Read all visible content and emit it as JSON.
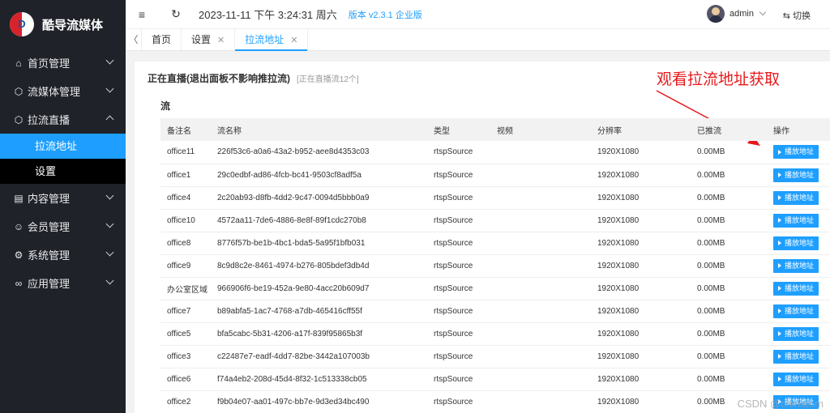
{
  "app": {
    "brand": "酷导流媒体",
    "logo_letter": "D"
  },
  "sidebar": {
    "items": [
      {
        "label": "首页管理",
        "icon": "home-icon",
        "glyph": "⌂"
      },
      {
        "label": "流媒体管理",
        "icon": "cube-icon",
        "glyph": "⬡"
      },
      {
        "label": "拉流直播",
        "icon": "cube-icon",
        "glyph": "⬡",
        "open": true
      },
      {
        "label": "内容管理",
        "icon": "document-icon",
        "glyph": "▤"
      },
      {
        "label": "会员管理",
        "icon": "users-icon",
        "glyph": "☺"
      },
      {
        "label": "系统管理",
        "icon": "gear-icon",
        "glyph": "⚙"
      },
      {
        "label": "应用管理",
        "icon": "link-icon",
        "glyph": "∞"
      }
    ],
    "sub_items": [
      {
        "label": "拉流地址",
        "active": true
      },
      {
        "label": "设置",
        "active": false
      }
    ]
  },
  "header": {
    "menu_icon": "≡",
    "refresh_icon": "↻",
    "datetime": "2023-11-11 下午 3:24:31 周六",
    "version": "版本 v2.3.1 企业版",
    "username": "admin",
    "switch_label": "⇆ 切换"
  },
  "tabs": {
    "prev": "〈",
    "items": [
      {
        "label": "首页",
        "closable": false,
        "active": false
      },
      {
        "label": "设置",
        "closable": true,
        "active": false
      },
      {
        "label": "拉流地址",
        "closable": true,
        "active": true
      }
    ]
  },
  "main": {
    "panel_title": "正在直播(退出面板不影响推拉流)",
    "panel_sub": "[正在直播流12个]",
    "annotation": "观看拉流地址获取",
    "section_label": "流",
    "columns": [
      "备注名",
      "流名称",
      "类型",
      "视频",
      "分辨率",
      "已推流",
      "操作"
    ],
    "play_label": "播放地址",
    "rows": [
      {
        "name": "office11",
        "stream": "226f53c6-a0a6-43a2-b952-aee8d4353c03",
        "type": "rtspSource",
        "video": "",
        "res": "1920X1080",
        "pushed": "0.00MB"
      },
      {
        "name": "office1",
        "stream": "29c0edbf-ad86-4fcb-bc41-9503cf8adf5a",
        "type": "rtspSource",
        "video": "",
        "res": "1920X1080",
        "pushed": "0.00MB"
      },
      {
        "name": "office4",
        "stream": "2c20ab93-d8fb-4dd2-9c47-0094d5bbb0a9",
        "type": "rtspSource",
        "video": "",
        "res": "1920X1080",
        "pushed": "0.00MB"
      },
      {
        "name": "office10",
        "stream": "4572aa11-7de6-4886-8e8f-89f1cdc270b8",
        "type": "rtspSource",
        "video": "",
        "res": "1920X1080",
        "pushed": "0.00MB"
      },
      {
        "name": "office8",
        "stream": "8776f57b-be1b-4bc1-bda5-5a95f1bfb031",
        "type": "rtspSource",
        "video": "",
        "res": "1920X1080",
        "pushed": "0.00MB"
      },
      {
        "name": "office9",
        "stream": "8c9d8c2e-8461-4974-b276-805bdef3db4d",
        "type": "rtspSource",
        "video": "",
        "res": "1920X1080",
        "pushed": "0.00MB"
      },
      {
        "name": "办公室区域",
        "stream": "966906f6-be19-452a-9e80-4acc20b609d7",
        "type": "rtspSource",
        "video": "",
        "res": "1920X1080",
        "pushed": "0.00MB"
      },
      {
        "name": "office7",
        "stream": "b89abfa5-1ac7-4768-a7db-465416cff55f",
        "type": "rtspSource",
        "video": "",
        "res": "1920X1080",
        "pushed": "0.00MB"
      },
      {
        "name": "office5",
        "stream": "bfa5cabc-5b31-4206-a17f-839f95865b3f",
        "type": "rtspSource",
        "video": "",
        "res": "1920X1080",
        "pushed": "0.00MB"
      },
      {
        "name": "office3",
        "stream": "c22487e7-eadf-4dd7-82be-3442a107003b",
        "type": "rtspSource",
        "video": "",
        "res": "1920X1080",
        "pushed": "0.00MB"
      },
      {
        "name": "office6",
        "stream": "f74a4eb2-208d-45d4-8f32-1c513338cb05",
        "type": "rtspSource",
        "video": "",
        "res": "1920X1080",
        "pushed": "0.00MB"
      },
      {
        "name": "office2",
        "stream": "f9b04e07-aa01-497c-bb7e-9d3ed34bc490",
        "type": "rtspSource",
        "video": "",
        "res": "1920X1080",
        "pushed": "0.00MB"
      }
    ]
  },
  "watermark": "CSDN @chinatom",
  "colors": {
    "sidebar": "#20222a",
    "accent": "#1e9fff",
    "annotation": "#e5191c"
  }
}
